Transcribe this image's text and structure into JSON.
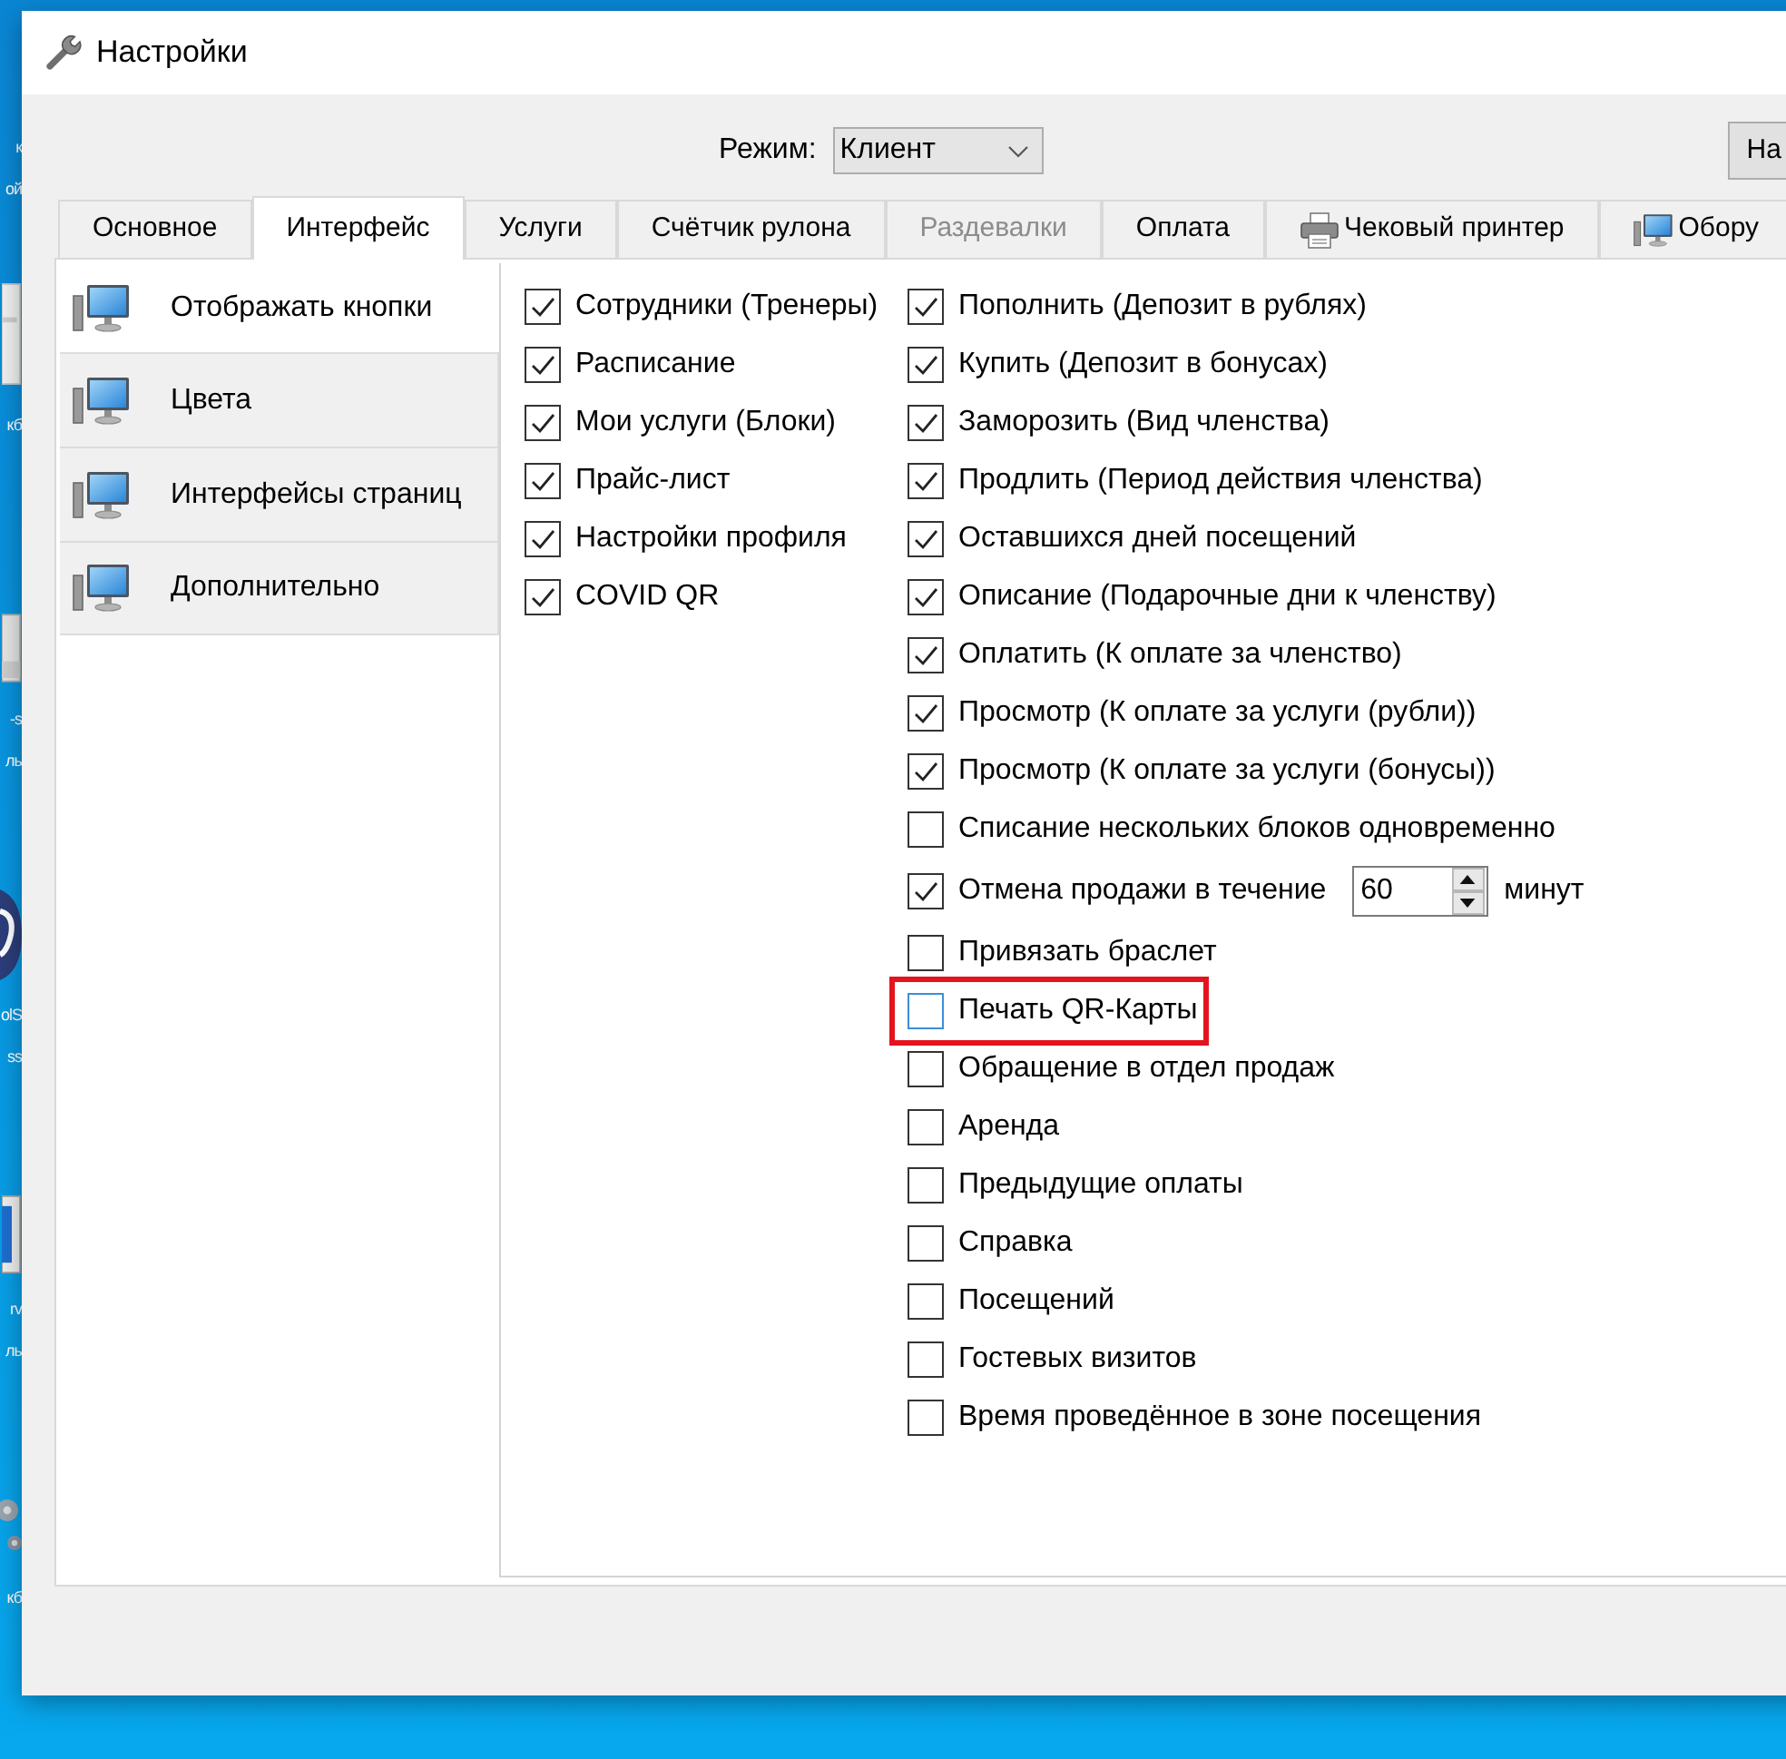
{
  "desktop": {
    "icons": [
      {
        "kind": "none",
        "label_lines": [
          "к",
          "ой"
        ]
      },
      {
        "kind": "document",
        "label_lines": [
          "кб"
        ]
      },
      {
        "kind": "app",
        "label_lines": [
          "-s",
          "ль"
        ]
      },
      {
        "kind": "logo",
        "label_lines": [
          "olS",
          "ss"
        ]
      },
      {
        "kind": "window",
        "label_lines": [
          "rv",
          "ль"
        ]
      },
      {
        "kind": "gears",
        "label_lines": [
          "кб"
        ]
      }
    ]
  },
  "window": {
    "title": "Настройки"
  },
  "mode": {
    "label": "Режим:",
    "value": "Клиент"
  },
  "toolbar_button": {
    "label": "На"
  },
  "tabs": [
    {
      "kind": "text",
      "label": "Основное",
      "selected": false,
      "disabled": false
    },
    {
      "kind": "text",
      "label": "Интерфейс",
      "selected": true,
      "disabled": false
    },
    {
      "kind": "text",
      "label": "Услуги",
      "selected": false,
      "disabled": false
    },
    {
      "kind": "text",
      "label": "Счётчик рулона",
      "selected": false,
      "disabled": false
    },
    {
      "kind": "text",
      "label": "Раздевалки",
      "selected": false,
      "disabled": true
    },
    {
      "kind": "text",
      "label": "Оплата",
      "selected": false,
      "disabled": false
    },
    {
      "kind": "printer",
      "label": "Чековый принтер",
      "selected": false,
      "disabled": false
    },
    {
      "kind": "computer",
      "label": "Обору",
      "selected": false,
      "disabled": false
    }
  ],
  "sidebar": {
    "items": [
      {
        "label": "Отображать кнопки",
        "selected": true
      },
      {
        "label": "Цвета",
        "selected": false
      },
      {
        "label": "Интерфейсы страниц",
        "selected": false
      },
      {
        "label": "Дополнительно",
        "selected": false
      }
    ]
  },
  "options_left": [
    {
      "label": "Сотрудники (Тренеры)",
      "checked": true
    },
    {
      "label": "Расписание",
      "checked": true
    },
    {
      "label": "Мои услуги (Блоки)",
      "checked": true
    },
    {
      "label": "Прайс-лист",
      "checked": true
    },
    {
      "label": "Настройки профиля",
      "checked": true
    },
    {
      "label": "COVID QR",
      "checked": true
    }
  ],
  "options_right": [
    {
      "kind": "checkbox",
      "label": "Пополнить (Депозит в рублях)",
      "checked": true,
      "highlighted": false,
      "hovered": false
    },
    {
      "kind": "checkbox",
      "label": "Купить (Депозит в бонусах)",
      "checked": true,
      "highlighted": false,
      "hovered": false
    },
    {
      "kind": "checkbox",
      "label": "Заморозить (Вид членства)",
      "checked": true,
      "highlighted": false,
      "hovered": false
    },
    {
      "kind": "checkbox",
      "label": "Продлить (Период действия членства)",
      "checked": true,
      "highlighted": false,
      "hovered": false
    },
    {
      "kind": "checkbox",
      "label": "Оставшихся дней посещений",
      "checked": true,
      "highlighted": false,
      "hovered": false
    },
    {
      "kind": "checkbox",
      "label": "Описание (Подарочные дни к членству)",
      "checked": true,
      "highlighted": false,
      "hovered": false
    },
    {
      "kind": "checkbox",
      "label": "Оплатить (К оплате за членство)",
      "checked": true,
      "highlighted": false,
      "hovered": false
    },
    {
      "kind": "checkbox",
      "label": "Просмотр (К оплате за услуги (рубли))",
      "checked": true,
      "highlighted": false,
      "hovered": false
    },
    {
      "kind": "checkbox",
      "label": "Просмотр (К оплате за услуги (бонусы))",
      "checked": true,
      "highlighted": false,
      "hovered": false
    },
    {
      "kind": "checkbox",
      "label": "Списание нескольких блоков одновременно",
      "checked": false,
      "highlighted": false,
      "hovered": false
    },
    {
      "kind": "number",
      "label": "Отмена продажи в течение",
      "checked": true,
      "highlighted": false,
      "hovered": false,
      "value": "60",
      "unit": "минут"
    },
    {
      "kind": "checkbox",
      "label": "Привязать браслет",
      "checked": false,
      "highlighted": false,
      "hovered": false
    },
    {
      "kind": "checkbox",
      "label": "Печать QR-Карты",
      "checked": false,
      "highlighted": true,
      "hovered": true
    },
    {
      "kind": "checkbox",
      "label": "Обращение в отдел продаж",
      "checked": false,
      "highlighted": false,
      "hovered": false
    },
    {
      "kind": "checkbox",
      "label": "Аренда",
      "checked": false,
      "highlighted": false,
      "hovered": false
    },
    {
      "kind": "checkbox",
      "label": "Предыдущие оплаты",
      "checked": false,
      "highlighted": false,
      "hovered": false
    },
    {
      "kind": "checkbox",
      "label": "Справка",
      "checked": false,
      "highlighted": false,
      "hovered": false
    },
    {
      "kind": "checkbox",
      "label": "Посещений",
      "checked": false,
      "highlighted": false,
      "hovered": false
    },
    {
      "kind": "checkbox",
      "label": "Гостевых визитов",
      "checked": false,
      "highlighted": false,
      "hovered": false
    },
    {
      "kind": "checkbox",
      "label": "Время проведённое в зоне посещения",
      "checked": false,
      "highlighted": false,
      "hovered": false
    }
  ]
}
